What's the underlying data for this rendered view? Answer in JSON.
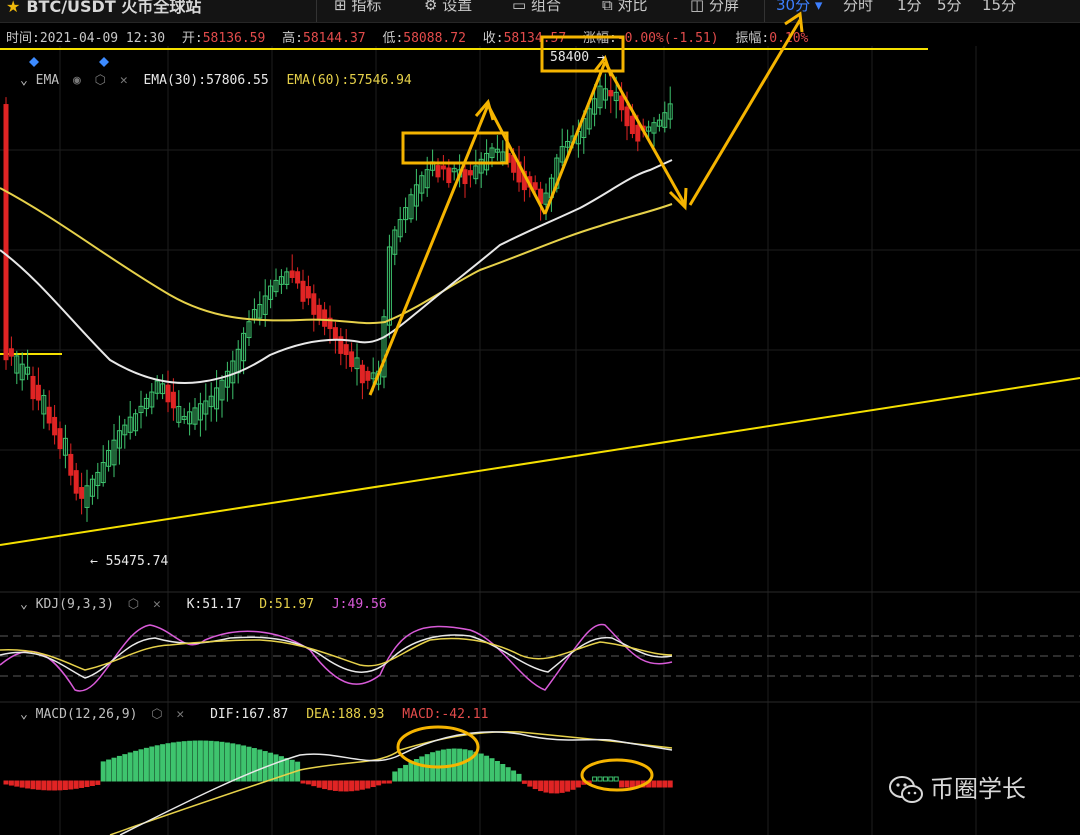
{
  "topbar": {
    "pair_title": "BTC/USDT 火币全球站",
    "menu": [
      "指标",
      "设置",
      "组合",
      "对比",
      "分屏"
    ],
    "timeframes": [
      "30分",
      "分时",
      "1分",
      "5分",
      "15分"
    ],
    "active_timeframe": "30分"
  },
  "info": {
    "time_label": "时间:",
    "time": "2021-04-09 12:30",
    "open_label": "开:",
    "open": "58136.59",
    "high_label": "高:",
    "high": "58144.37",
    "low_label": "低:",
    "low": "58088.72",
    "close_label": "收:",
    "close": "58134.57",
    "change_label": "涨幅:",
    "change": "-0.00%(-1.51)",
    "amplitude_label": "振幅:",
    "amplitude": "0.10%"
  },
  "ema": {
    "name": "EMA",
    "ema30_label": "EMA(30):57806.55",
    "ema60_label": "EMA(60):57546.94"
  },
  "kdj": {
    "name": "KDJ(9,3,3)",
    "k_label": "K:51.17",
    "d_label": "D:51.97",
    "j_label": "J:49.56"
  },
  "macd": {
    "name": "MACD(12,26,9)",
    "dif_label": "DIF:167.87",
    "dea_label": "DEA:188.93",
    "macd_label": "MACD:-42.11"
  },
  "annotations": {
    "high_marker": "58400",
    "low_marker": "55475.74"
  },
  "watermark": "币圈学长",
  "colors": {
    "up": "#3ec46e",
    "down": "#e02424",
    "ema30": "#e8e8e8",
    "ema60": "#e6d14a",
    "annotation": "#f5b400"
  }
}
